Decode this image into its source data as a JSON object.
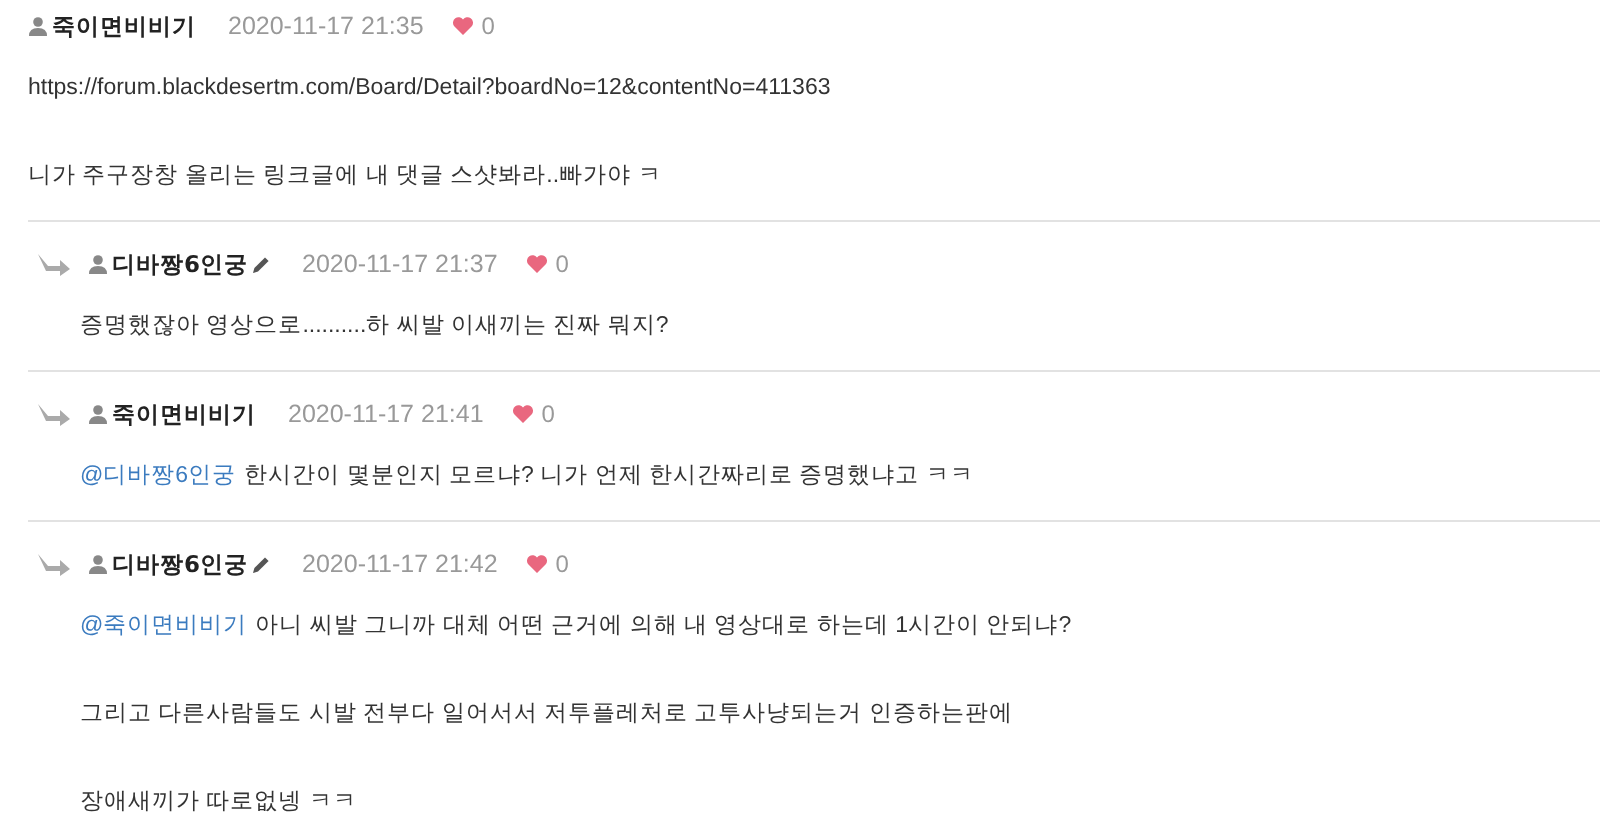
{
  "comments": [
    {
      "kind": "post",
      "author": "죽이면비비기",
      "edited": false,
      "time": "2020-11-17 21:35",
      "likes": "0",
      "paragraphs": [
        {
          "text": "https://forum.blackdesertm.com/Board/Detail?boardNo=12&contentNo=411363"
        },
        {
          "text": "니가 주구장창 올리는 링크글에 내 댓글 스샷봐라..빠가야 ㅋ"
        }
      ]
    },
    {
      "kind": "reply",
      "author": "디바짱6인궁",
      "edited": true,
      "time": "2020-11-17 21:37",
      "likes": "0",
      "paragraphs": [
        {
          "text": "증명했잖아 영상으로..........하 씨발 이새끼는 진짜 뭐지?"
        }
      ]
    },
    {
      "kind": "reply",
      "author": "죽이면비비기",
      "edited": false,
      "time": "2020-11-17 21:41",
      "likes": "0",
      "paragraphs": [
        {
          "mention": "@디바짱6인궁",
          "text": "한시간이 몇분인지 모르냐? 니가 언제 한시간짜리로 증명했냐고 ㅋㅋ"
        }
      ]
    },
    {
      "kind": "reply",
      "author": "디바짱6인궁",
      "edited": true,
      "time": "2020-11-17 21:42",
      "likes": "0",
      "paragraphs": [
        {
          "mention": "@죽이면비비기",
          "text": "아니 씨발 그니까 대체 어떤 근거에 의해 내 영상대로 하는데 1시간이 안되냐?"
        },
        {
          "text": "그리고 다른사람들도 시발 전부다 일어서서 저투플레처로 고투사냥되는거 인증하는판에"
        },
        {
          "text": "장애새끼가 따로없넹 ㅋㅋ"
        }
      ]
    }
  ]
}
